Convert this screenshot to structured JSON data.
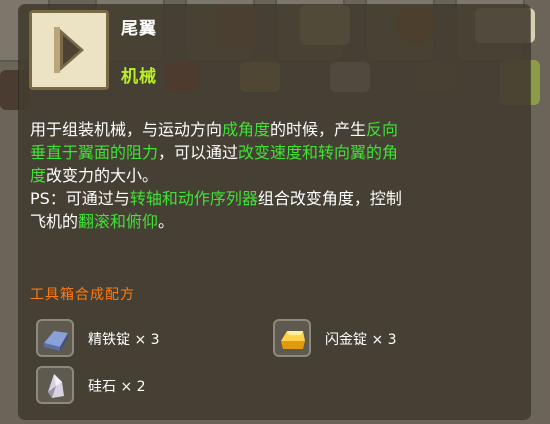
{
  "item": {
    "name": "尾翼",
    "category": "机械",
    "icon": "tail-wing-icon"
  },
  "description": {
    "lines": [
      [
        {
          "text": "用于组装机械，与运动方向",
          "hl": false
        },
        {
          "text": "成角度",
          "hl": true
        },
        {
          "text": "的时候，产生",
          "hl": false
        },
        {
          "text": "反向",
          "hl": true
        }
      ],
      [
        {
          "text": "垂直于翼面的阻力",
          "hl": true
        },
        {
          "text": "，可以通过",
          "hl": false
        },
        {
          "text": "改变速度和转向翼的角",
          "hl": true
        }
      ],
      [
        {
          "text": "度",
          "hl": true
        },
        {
          "text": "改变力的大小。",
          "hl": false
        }
      ],
      [
        {
          "text": "PS：可通过与",
          "hl": false
        },
        {
          "text": "转轴和动作序列器",
          "hl": true
        },
        {
          "text": "组合改变角度，控制",
          "hl": false
        }
      ],
      [
        {
          "text": "飞机的",
          "hl": false
        },
        {
          "text": "翻滚和俯仰",
          "hl": true
        },
        {
          "text": "。",
          "hl": false
        }
      ]
    ]
  },
  "recipe": {
    "title": "工具箱合成配方",
    "materials": [
      {
        "label": "精铁锭 × 3",
        "icon": "iron-ingot-icon"
      },
      {
        "label": "闪金锭 × 3",
        "icon": "gold-ingot-icon"
      },
      {
        "label": "硅石 × 2",
        "icon": "silica-stone-icon"
      }
    ]
  },
  "colors": {
    "highlight": "#3fe236",
    "category": "#b9ef2a",
    "recipe_title": "#ff7a12"
  }
}
